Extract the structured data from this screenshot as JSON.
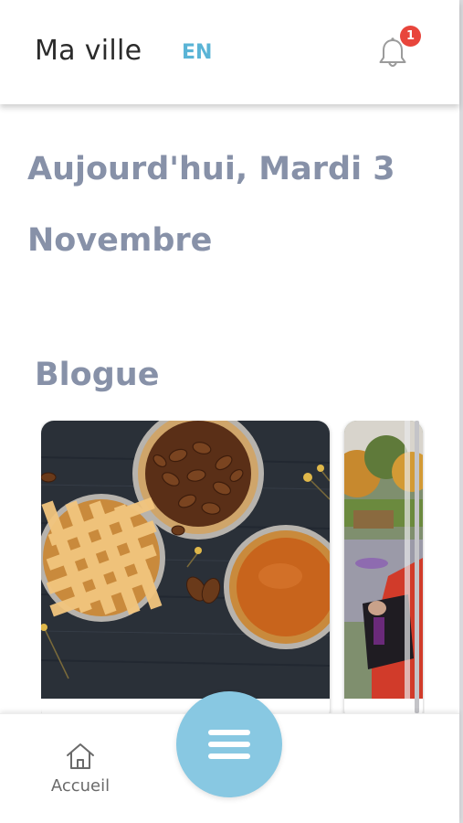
{
  "header": {
    "app_title": "Ma ville",
    "lang_toggle": "EN",
    "notification_count": "1"
  },
  "date_heading": "Aujourd'hui, Mardi 3 Novembre",
  "blog": {
    "section_title": "Blogue",
    "cards": [
      {
        "image": "pies-photo"
      },
      {
        "image": "halloween-photo"
      }
    ]
  },
  "bottom_nav": {
    "home_label": "Accueil",
    "home_icon": "home-icon",
    "menu_icon": "hamburger-menu-icon"
  },
  "colors": {
    "accent_blue": "#5ab4d6",
    "fab_blue": "#88c8e2",
    "heading_gray": "#8791a8",
    "badge_red": "#e8453c"
  }
}
